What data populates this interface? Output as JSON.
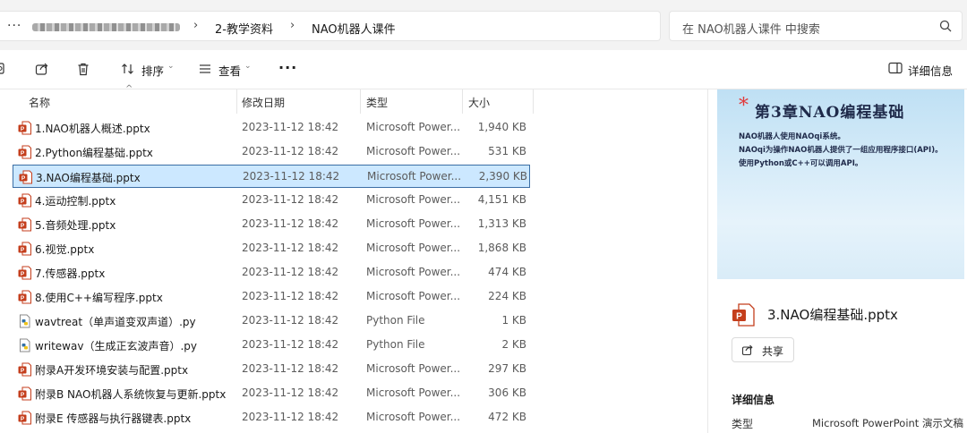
{
  "address": {
    "more_label": "···",
    "crumbs": [
      "2-教学资料",
      "NAO机器人课件"
    ],
    "separator": "›"
  },
  "search": {
    "placeholder": "在 NAO机器人课件 中搜索"
  },
  "toolbar": {
    "sort_label": "排序",
    "view_label": "查看",
    "more_label": "···",
    "details_label": "详细信息"
  },
  "columns": {
    "name": "名称",
    "modified": "修改日期",
    "type": "类型",
    "size": "大小"
  },
  "files": [
    {
      "name": "1.NAO机器人概述.pptx",
      "modified": "2023-11-12 18:42",
      "type": "Microsoft Power...",
      "size": "1,940 KB",
      "icon": "powerpoint-file-icon"
    },
    {
      "name": "2.Python编程基础.pptx",
      "modified": "2023-11-12 18:42",
      "type": "Microsoft Power...",
      "size": "531 KB",
      "icon": "powerpoint-file-icon"
    },
    {
      "name": "3.NAO编程基础.pptx",
      "modified": "2023-11-12 18:42",
      "type": "Microsoft Power...",
      "size": "2,390 KB",
      "icon": "powerpoint-file-icon",
      "selected": true
    },
    {
      "name": "4.运动控制.pptx",
      "modified": "2023-11-12 18:42",
      "type": "Microsoft Power...",
      "size": "4,151 KB",
      "icon": "powerpoint-file-icon"
    },
    {
      "name": "5.音频处理.pptx",
      "modified": "2023-11-12 18:42",
      "type": "Microsoft Power...",
      "size": "1,313 KB",
      "icon": "powerpoint-file-icon"
    },
    {
      "name": "6.视觉.pptx",
      "modified": "2023-11-12 18:42",
      "type": "Microsoft Power...",
      "size": "1,868 KB",
      "icon": "powerpoint-file-icon"
    },
    {
      "name": "7.传感器.pptx",
      "modified": "2023-11-12 18:42",
      "type": "Microsoft Power...",
      "size": "474 KB",
      "icon": "powerpoint-file-icon"
    },
    {
      "name": "8.使用C++编写程序.pptx",
      "modified": "2023-11-12 18:42",
      "type": "Microsoft Power...",
      "size": "224 KB",
      "icon": "powerpoint-file-icon"
    },
    {
      "name": "wavtreat（单声道变双声道）.py",
      "modified": "2023-11-12 18:42",
      "type": "Python File",
      "size": "1 KB",
      "icon": "python-file-icon"
    },
    {
      "name": "writewav（生成正玄波声音）.py",
      "modified": "2023-11-12 18:42",
      "type": "Python File",
      "size": "2 KB",
      "icon": "python-file-icon"
    },
    {
      "name": "附录A开发环境安装与配置.pptx",
      "modified": "2023-11-12 18:42",
      "type": "Microsoft Power...",
      "size": "297 KB",
      "icon": "powerpoint-file-icon"
    },
    {
      "name": "附录B NAO机器人系统恢复与更新.pptx",
      "modified": "2023-11-12 18:42",
      "type": "Microsoft Power...",
      "size": "306 KB",
      "icon": "powerpoint-file-icon"
    },
    {
      "name": "附录E 传感器与执行器键表.pptx",
      "modified": "2023-11-12 18:42",
      "type": "Microsoft Power...",
      "size": "472 KB",
      "icon": "powerpoint-file-icon"
    }
  ],
  "preview": {
    "star": "*",
    "title": "第3章NAO编程基础",
    "lines": [
      "NAO机器人使用NAOqi系统。",
      "NAOqi为操作NAO机器人提供了一组应用程序接口(API)。",
      "使用Python或C++可以调用API。"
    ]
  },
  "details": {
    "file_name": "3.NAO编程基础.pptx",
    "share_label": "共享",
    "section_title": "详细信息",
    "type_key": "类型",
    "type_value": "Microsoft PowerPoint 演示文稿"
  },
  "colors": {
    "selection_bg": "#cce8ff",
    "selection_border": "#3b6ea5",
    "powerpoint_red": "#c43e1c"
  }
}
